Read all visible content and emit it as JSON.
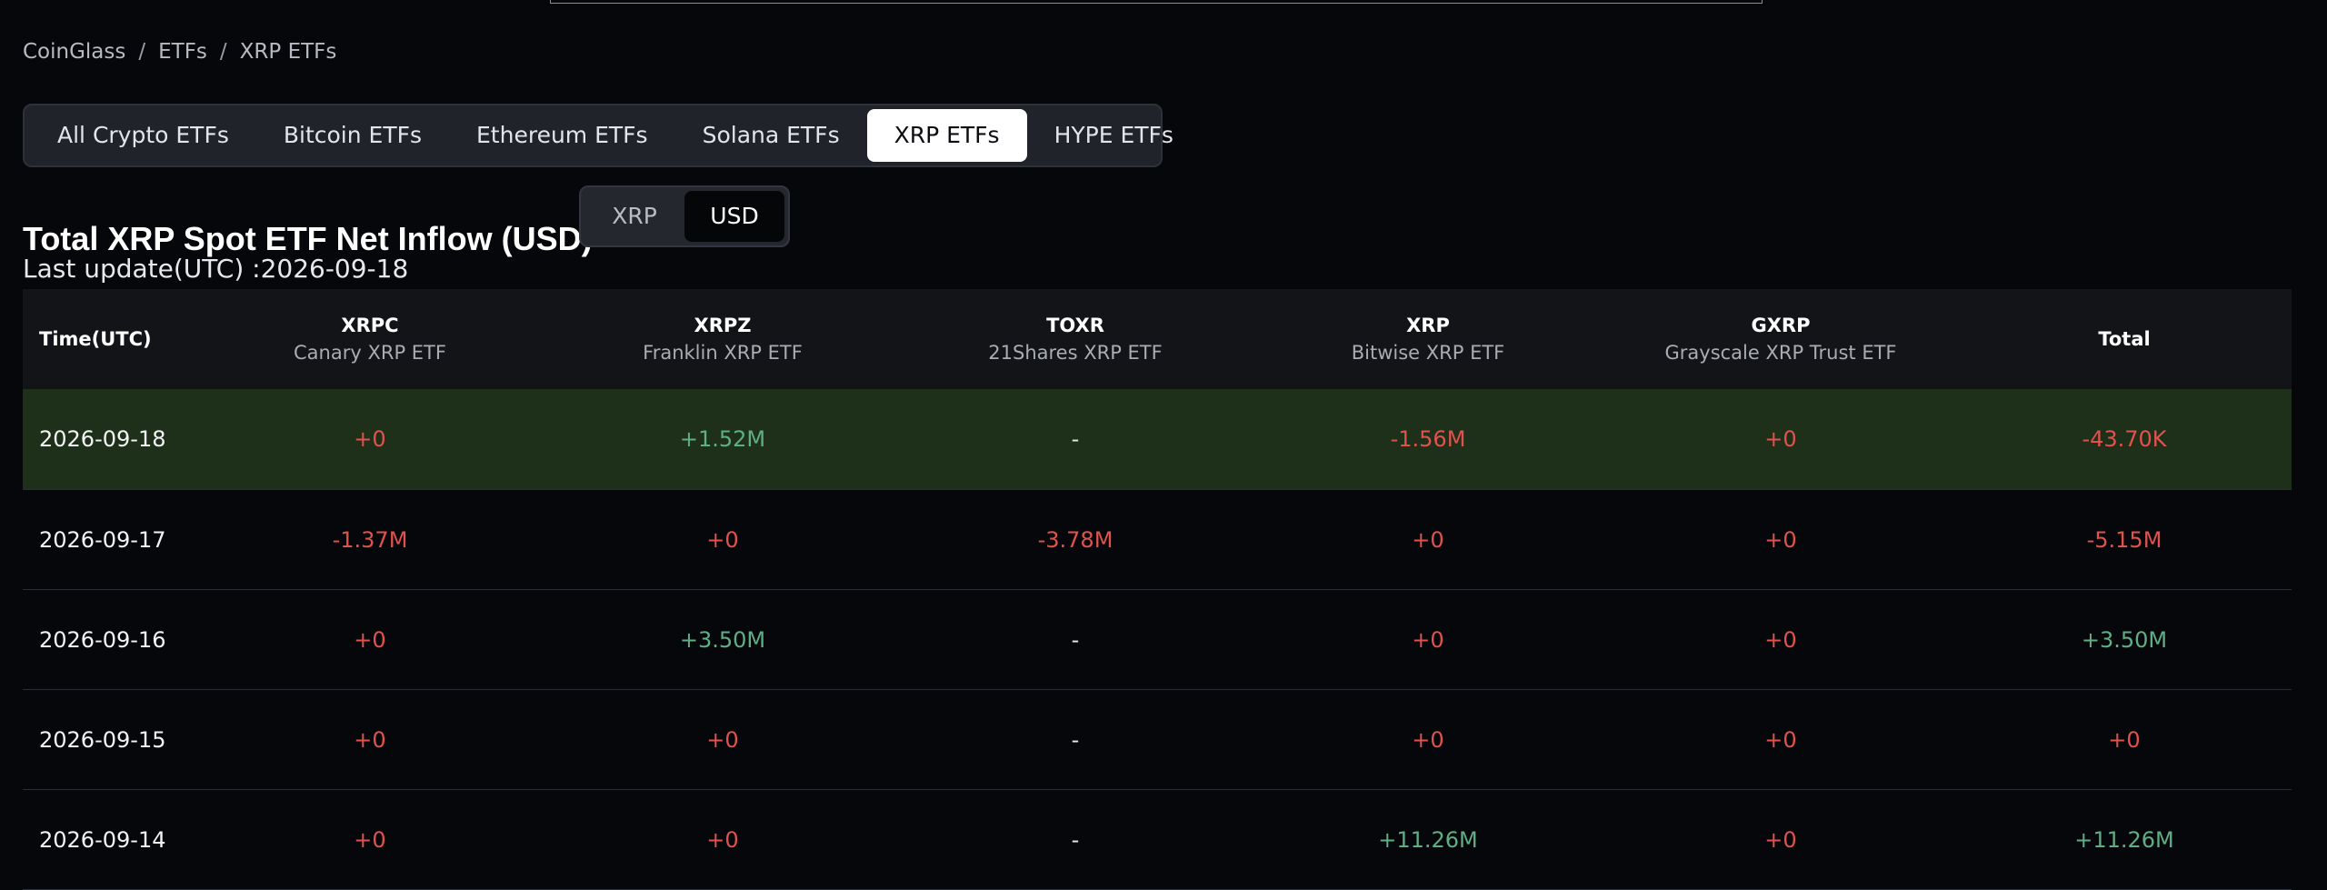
{
  "breadcrumb": [
    "CoinGlass",
    "ETFs",
    "XRP ETFs"
  ],
  "tabs": [
    "All Crypto ETFs",
    "Bitcoin ETFs",
    "Ethereum ETFs",
    "Solana ETFs",
    "XRP ETFs",
    "HYPE ETFs"
  ],
  "active_tab": "XRP ETFs",
  "title": "Total XRP Spot ETF Net Inflow (USD)",
  "unit_toggle": {
    "options": [
      "XRP",
      "USD"
    ],
    "selected": "USD"
  },
  "last_update": "Last update(UTC) :2026-09-18",
  "table": {
    "time_header": "Time(UTC)",
    "total_header": "Total",
    "funds": [
      {
        "code": "XRPC",
        "name": "Canary XRP ETF"
      },
      {
        "code": "XRPZ",
        "name": "Franklin XRP ETF"
      },
      {
        "code": "TOXR",
        "name": "21Shares XRP ETF"
      },
      {
        "code": "XRP",
        "name": "Bitwise XRP ETF"
      },
      {
        "code": "GXRP",
        "name": "Grayscale XRP Trust ETF"
      }
    ],
    "rows": [
      {
        "date": "2026-09-18",
        "values": [
          "+0",
          "+1.52M",
          "-",
          "-1.56M",
          "+0"
        ],
        "total": "-43.70K",
        "highlighted": true
      },
      {
        "date": "2026-09-17",
        "values": [
          "-1.37M",
          "+0",
          "-3.78M",
          "+0",
          "+0"
        ],
        "total": "-5.15M",
        "highlighted": false
      },
      {
        "date": "2026-09-16",
        "values": [
          "+0",
          "+3.50M",
          "-",
          "+0",
          "+0"
        ],
        "total": "+3.50M",
        "highlighted": false
      },
      {
        "date": "2026-09-15",
        "values": [
          "+0",
          "+0",
          "-",
          "+0",
          "+0"
        ],
        "total": "+0",
        "highlighted": false
      },
      {
        "date": "2026-09-14",
        "values": [
          "+0",
          "+0",
          "-",
          "+11.26M",
          "+0"
        ],
        "total": "+11.26M",
        "highlighted": false
      }
    ]
  },
  "colors": {
    "negative": "#e0524d",
    "positive": "#5fae86",
    "highlight_row": "#1f301a",
    "background": "#06070a"
  }
}
